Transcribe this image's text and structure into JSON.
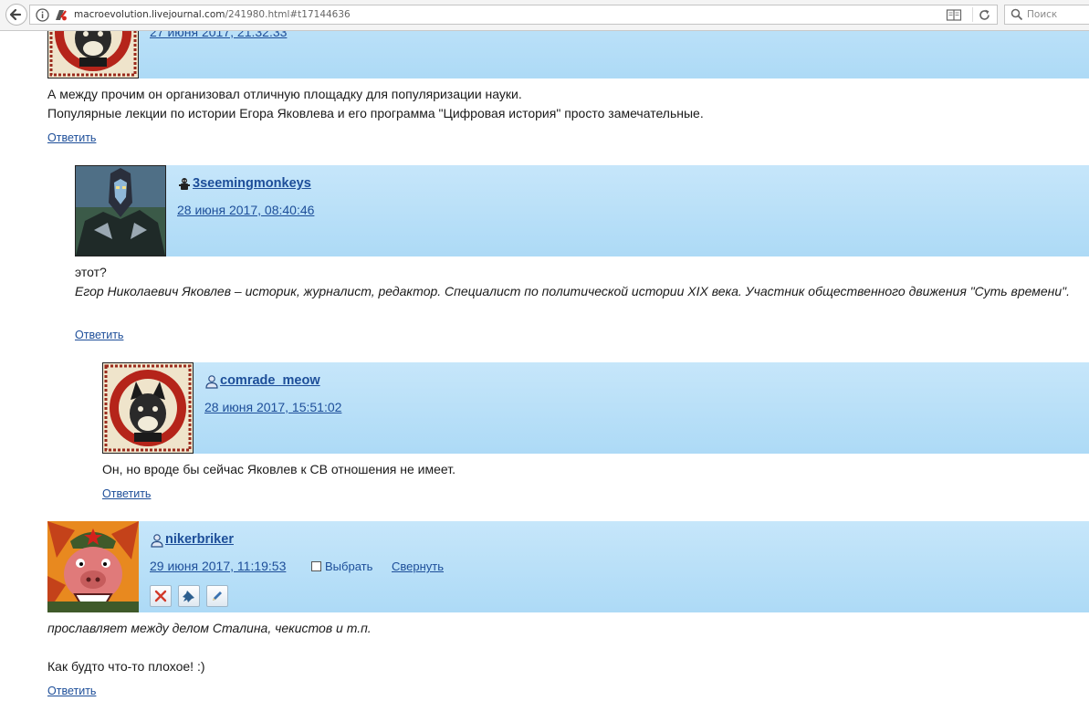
{
  "browser": {
    "url_domain": "macroevolution.livejournal.com",
    "url_path": "/241980.html#t17144636",
    "search_placeholder": "Поиск"
  },
  "comments": [
    {
      "username": "",
      "date": "27 июня 2017, 21:32:33",
      "text_lines": [
        "А между прочим он организовал отличную площадку для популяризации науки.",
        "Популярные лекции по истории Егора Яковлева и его программа \"Цифровая история\" просто замечательные."
      ],
      "reply_label": "Ответить"
    },
    {
      "username": "3seemingmonkeys",
      "date": "28 июня 2017, 08:40:46",
      "text_lines": [
        "этот?"
      ],
      "quote": "Егор Николаевич Яковлев – историк, журналист, редактор. Специалист по политической истории XIX века. Участник общественного движения \"Суть времени\".",
      "reply_label": "Ответить"
    },
    {
      "username": "comrade_meow",
      "date": "28 июня 2017, 15:51:02",
      "text_lines": [
        "Он, но вроде бы сейчас Яковлев к СВ отношения не имеет."
      ],
      "reply_label": "Ответить"
    },
    {
      "username": "nikerbriker",
      "date": "29 июня 2017, 11:19:53",
      "choose_label": "Выбрать",
      "collapse_label": "Свернуть",
      "italic_line": "прославляет между делом Сталина, чекистов и т.п.",
      "text_lines": [
        "Как будто что-то плохое! :)"
      ],
      "reply_label": "Ответить"
    }
  ],
  "icons": {
    "nav": "back-arrow-icon",
    "info": "info-icon",
    "mixed_content": "mixed-content-shield-icon",
    "reader": "reader-view-icon",
    "reload": "reload-icon",
    "search": "search-icon",
    "user": "user-icon",
    "community_user": "monkey-user-icon",
    "delete": "delete-x-icon",
    "freeze": "pin-freeze-icon",
    "edit": "edit-pencil-icon"
  },
  "colors": {
    "link": "#1d4e99",
    "header_band": "#addaf6",
    "delete": "#d23a2a"
  }
}
